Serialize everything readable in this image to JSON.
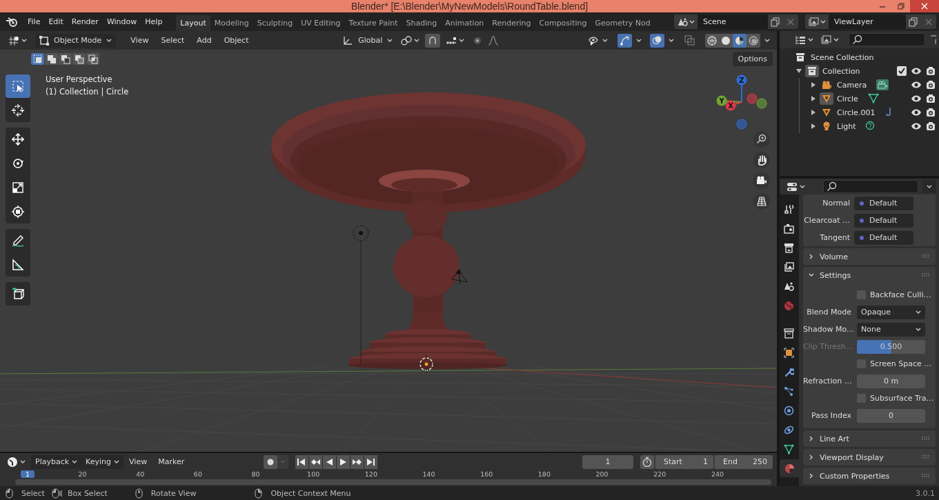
{
  "window": {
    "title": "Blender* [E:\\Blender\\MyNewModels\\RoundTable.blend]"
  },
  "menu": [
    "File",
    "Edit",
    "Render",
    "Window",
    "Help"
  ],
  "workspaces": [
    {
      "label": "Layout",
      "selected": true
    },
    {
      "label": "Modeling",
      "selected": false
    },
    {
      "label": "Sculpting",
      "selected": false
    },
    {
      "label": "UV Editing",
      "selected": false
    },
    {
      "label": "Texture Paint",
      "selected": false
    },
    {
      "label": "Shading",
      "selected": false
    },
    {
      "label": "Animation",
      "selected": false
    },
    {
      "label": "Rendering",
      "selected": false
    },
    {
      "label": "Compositing",
      "selected": false
    },
    {
      "label": "Geometry Nod",
      "selected": false
    }
  ],
  "scene": {
    "value": "Scene"
  },
  "view_layer": {
    "value": "ViewLayer"
  },
  "viewport": {
    "mode": "Object Mode",
    "menus": [
      "View",
      "Select",
      "Add",
      "Object"
    ],
    "orientation": "Global",
    "toggles": [
      {
        "kind": "gizmo",
        "on": true
      },
      {
        "kind": "overlay",
        "on": true
      },
      {
        "kind": "xray",
        "on": false
      }
    ],
    "shading": [
      {
        "kind": "wireframe",
        "selected": false
      },
      {
        "kind": "solid",
        "selected": false
      },
      {
        "kind": "material",
        "selected": true
      },
      {
        "kind": "rendered",
        "selected": false
      }
    ],
    "select_modes": [
      {
        "kind": "set",
        "selected": true
      },
      {
        "kind": "extend",
        "selected": false
      },
      {
        "kind": "subtract",
        "selected": false
      },
      {
        "kind": "invert",
        "selected": false
      },
      {
        "kind": "intersect",
        "selected": false
      }
    ],
    "tool_groups": [
      [
        {
          "kind": "select",
          "selected": true
        },
        {
          "kind": "cursor",
          "selected": false
        }
      ],
      [
        {
          "kind": "move",
          "selected": false
        },
        {
          "kind": "rotate",
          "selected": false
        },
        {
          "kind": "scale",
          "selected": false
        },
        {
          "kind": "transform",
          "selected": false
        }
      ],
      [
        {
          "kind": "annotate",
          "selected": false
        },
        {
          "kind": "measure",
          "selected": false
        }
      ],
      [
        {
          "kind": "add_cube",
          "selected": false
        }
      ]
    ],
    "info": [
      "User Perspective",
      "(1) Collection | Circle"
    ],
    "options": "Options",
    "gizmo": [
      {
        "label": "Z",
        "color": "#2e6bd6"
      },
      {
        "label": "Y",
        "color": "#6fa836"
      },
      {
        "label": "X",
        "color": "#d93b4d"
      }
    ]
  },
  "outliner": {
    "tree": [
      {
        "label": "Scene Collection",
        "kind": "scene_collection",
        "children": [
          {
            "label": "Collection",
            "kind": "collection",
            "expanded": true,
            "checked": true,
            "children": [
              {
                "label": "Camera",
                "kind": "camera",
                "expanded": false,
                "selected": false
              },
              {
                "label": "Circle",
                "kind": "mesh",
                "expanded": false,
                "selected": true
              },
              {
                "label": "Circle.001",
                "kind": "curve",
                "expanded": false,
                "selected": false
              },
              {
                "label": "Light",
                "kind": "light",
                "expanded": false,
                "selected": false
              }
            ]
          }
        ]
      }
    ]
  },
  "properties": {
    "tabs": [
      {
        "kind": "tool",
        "selected": false
      },
      {
        "kind": "render",
        "selected": false
      },
      {
        "kind": "output",
        "selected": false
      },
      {
        "kind": "view_layer",
        "selected": false
      },
      {
        "kind": "scene",
        "selected": false
      },
      {
        "kind": "world",
        "selected": false
      },
      {
        "kind": "collection",
        "selected": false
      },
      {
        "kind": "object",
        "selected": false
      },
      {
        "kind": "modifier",
        "selected": false
      },
      {
        "kind": "particles",
        "selected": false
      },
      {
        "kind": "physics",
        "selected": false
      },
      {
        "kind": "constraints",
        "selected": false
      },
      {
        "kind": "data",
        "selected": false
      },
      {
        "kind": "material",
        "selected": true
      }
    ],
    "sockets": [
      {
        "label": "Normal",
        "value": "Default"
      },
      {
        "label": "Clearcoat …",
        "value": "Default"
      },
      {
        "label": "Tangent",
        "value": "Default"
      }
    ],
    "panels": [
      {
        "title": "Volume",
        "expanded": false
      },
      {
        "title": "Settings",
        "expanded": true,
        "rows": [
          {
            "kind": "checkbox",
            "label": "Backface Culli…",
            "checked": false
          },
          {
            "kind": "dropdown",
            "label": "Blend Mode",
            "value": "Opaque"
          },
          {
            "kind": "dropdown",
            "label": "Shadow Mo…",
            "value": "None"
          },
          {
            "kind": "slider",
            "label": "Clip Thresh…",
            "value": "0.500",
            "level": 0.5,
            "disabled": true
          },
          {
            "kind": "checkbox",
            "label": "Screen Space …",
            "checked": false
          },
          {
            "kind": "number",
            "label": "Refraction …",
            "value": "0 m"
          },
          {
            "kind": "checkbox",
            "label": "Subsurface Tra…",
            "checked": false
          },
          {
            "kind": "number",
            "label": "Pass Index",
            "value": "0"
          }
        ]
      },
      {
        "title": "Line Art",
        "expanded": false
      },
      {
        "title": "Viewport Display",
        "expanded": false
      },
      {
        "title": "Custom Properties",
        "expanded": false
      }
    ]
  },
  "timeline": {
    "menus": [
      {
        "label": "Playback",
        "kind": "dropdown"
      },
      {
        "label": "Keying",
        "kind": "dropdown"
      },
      {
        "label": "View",
        "kind": "menu"
      },
      {
        "label": "Marker",
        "kind": "menu"
      }
    ],
    "auto_keying": {
      "on": false
    },
    "current_frame": "1",
    "start": {
      "label": "Start",
      "value": "1"
    },
    "end": {
      "label": "End",
      "value": "250"
    },
    "ruler": [
      "1",
      "20",
      "40",
      "60",
      "80",
      "100",
      "120",
      "140",
      "160",
      "180",
      "200",
      "220",
      "240"
    ]
  },
  "status_bar": {
    "hints": [
      {
        "label": "Select",
        "kind": "left"
      },
      {
        "label": "Box Select",
        "kind": "drag"
      },
      {
        "label": "Rotate View",
        "kind": "middle"
      },
      {
        "label": "Object Context Menu",
        "kind": "right"
      }
    ],
    "version": "3.0.1"
  }
}
